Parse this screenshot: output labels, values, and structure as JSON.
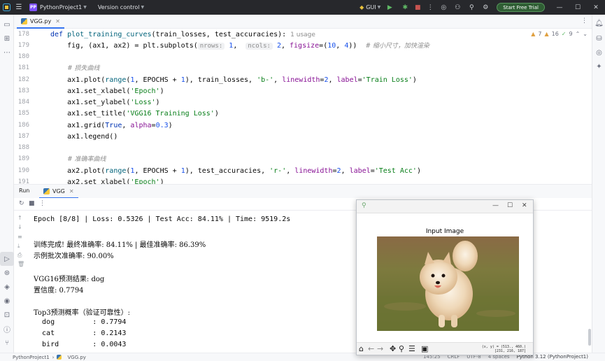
{
  "titlebar": {
    "project_badge": "PP",
    "project_name": "PythonProject1",
    "vcs": "Version control",
    "run_config": "GUI",
    "trial_button": "Start Free Trial"
  },
  "editor": {
    "tab_label": "VGG.py",
    "inspections": {
      "warnings": "7",
      "weak": "16",
      "typos": "9"
    },
    "line_numbers": [
      "178",
      "179",
      "180",
      "181",
      "182",
      "183",
      "184",
      "185",
      "186",
      "187",
      "188",
      "189",
      "190",
      "191"
    ],
    "line_178": {
      "def": "def",
      "name": "plot_training_curves",
      "args": "(train_losses, test_accuracies):",
      "usage": "1 usage"
    },
    "line_179": {
      "a": "fig, (ax1, ax2) = plt.subplots(",
      "h1": "nrows:",
      "v1": "1",
      "c1": ",",
      "h2": "ncols:",
      "v2": "2",
      "c2": ", ",
      "k": "figsize",
      "eq": "=(",
      "n1": "10",
      "cm": ", ",
      "n2": "4",
      "end": "))",
      "comment": "# 缩小尺寸，加快渲染"
    },
    "line_181": {
      "comment": "# 损失曲线"
    },
    "line_182": {
      "a": "ax1.plot(",
      "range": "range",
      "b": "(",
      "n1": "1",
      "c": ", EPOCHS + ",
      "n2": "1",
      "d": "), train_losses, ",
      "s1": "'b-'",
      "e": ", ",
      "k1": "linewidth",
      "f": "=",
      "n3": "2",
      "g": ", ",
      "k2": "label",
      "h": "=",
      "s2": "'Train Loss'",
      "end": ")"
    },
    "line_183": {
      "a": "ax1.set_xlabel(",
      "s": "'Epoch'",
      "end": ")"
    },
    "line_184": {
      "a": "ax1.set_ylabel(",
      "s": "'Loss'",
      "end": ")"
    },
    "line_185": {
      "a": "ax1.set_title(",
      "s": "'VGG16 Training Loss'",
      "end": ")"
    },
    "line_186": {
      "a": "ax1.grid(",
      "t": "True",
      "b": ", ",
      "k": "alpha",
      "eq": "=",
      "n": "0.3",
      "end": ")"
    },
    "line_187": {
      "a": "ax1.legend()"
    },
    "line_189": {
      "comment": "# 准确率曲线"
    },
    "line_190": {
      "a": "ax2.plot(",
      "range": "range",
      "b": "(",
      "n1": "1",
      "c": ", EPOCHS + ",
      "n2": "1",
      "d": "), test_accuracies, ",
      "s1": "'r-'",
      "e": ", ",
      "k1": "linewidth",
      "f": "=",
      "n3": "2",
      "g": ", ",
      "k2": "label",
      "h": "=",
      "s2": "'Test Acc'",
      "end": ")"
    },
    "line_191": {
      "a": "ax2.set_xlabel(",
      "s": "'Epoch'",
      "end": ")"
    }
  },
  "run_panel": {
    "label": "Run",
    "tab_label": "VGG",
    "console_lines": [
      "Epoch [8/8] | Loss: 0.5326 | Test Acc: 84.11% | Time: 9519.2s",
      "",
      "训练完成! 最终准确率: 84.11% | 最佳准确率: 86.39%",
      "示例批次准确率: 90.00%",
      "",
      "VGG16预测结果: dog",
      "置信度: 0.7794",
      "",
      "Top3预测概率（验证可靠性）:",
      "  dog         : 0.7794",
      "  cat         : 0.2143",
      "  bird        : 0.0043"
    ]
  },
  "plot_window": {
    "figure_title": "Input Image",
    "coords_line1": "(x, y) = (513., 460.)",
    "coords_line2": "[231, 216, 187]"
  },
  "statusbar": {
    "project": "PythonProject1",
    "file": "VGG.py",
    "position": "145:25",
    "line_sep": "CRLF",
    "encoding": "UTF-8",
    "indent": "4 spaces",
    "interpreter": "Python 3.12 (PythonProject1)"
  },
  "colors": {
    "accent": "#3574f0",
    "titlebar_bg": "#27282c",
    "keyword": "#0033b3",
    "string": "#067d17",
    "number": "#1750eb"
  }
}
